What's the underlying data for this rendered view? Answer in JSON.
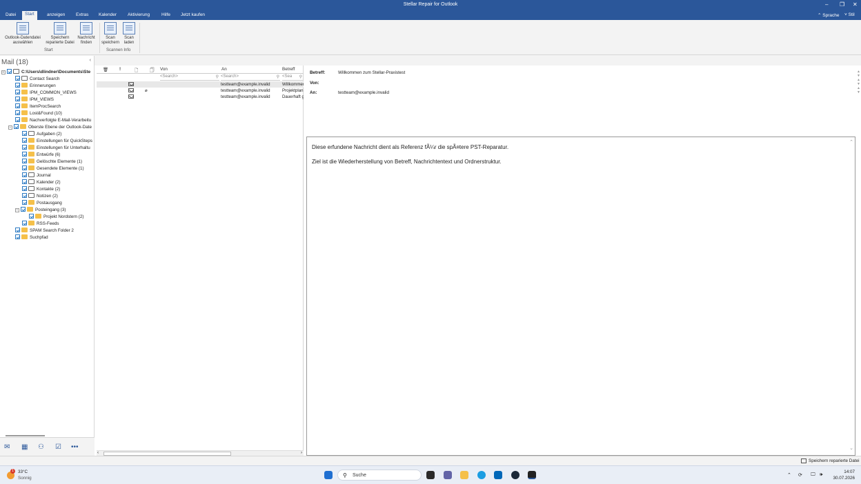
{
  "window": {
    "title": "Stellar Repair for Outlook"
  },
  "menu": {
    "items": [
      "Datei",
      "Start",
      "anzeigen",
      "Extras",
      "Kalender",
      "Aktivierung",
      "Hilfe",
      "Jetzt kaufen"
    ],
    "active": "Start",
    "sprache": "Sprache",
    "stil": "Stil"
  },
  "ribbon": {
    "buttons": [
      {
        "label1": "Outlook-Datendatei",
        "label2": "auswählen"
      },
      {
        "label1": "Speichern",
        "label2": "reparierte Datei"
      },
      {
        "label1": "Nachricht",
        "label2": "finden"
      },
      {
        "label1": "Scan",
        "label2": "speichern"
      },
      {
        "label1": "Scan",
        "label2": "laden"
      }
    ],
    "groups": [
      "Start",
      "Scannen Info"
    ]
  },
  "folders": {
    "title": "Mail (18)",
    "root": "C:\\Users\\dlindner\\Documents\\Ste",
    "items": [
      "Contact Search",
      "Erinnerungen",
      "IPM_COMMON_VIEWS",
      "IPM_VIEWS",
      "ItemProcSearch",
      "Lost&Found (10)",
      "Nachverfolgte E-Mail-Verarbeitu",
      "Oberste Ebene der Outlook-Date",
      "Aufgaben (2)",
      "Einstellungen für QuickSteps",
      "Einstellungen für Unterhaltu",
      "Entwürfe (6)",
      "Gelöschte Elemente (1)",
      "Gesendete Elemente (1)",
      "Journal",
      "Kalender (2)",
      "Kontakte (2)",
      "Notizen (2)",
      "Postausgang",
      "Posteingang (3)",
      "Projekt Nordstern (2)",
      "RSS-Feeds",
      "SPAM Search Folder 2",
      "Suchpfad"
    ]
  },
  "list": {
    "headers": {
      "from": "Von",
      "to": "An",
      "subject": "Betreff"
    },
    "search_placeholder": "<Search>",
    "search_short": "<Sea",
    "rows": [
      {
        "to": "testteam@example.invalid",
        "subject": "Willkommen"
      },
      {
        "to": "testteam@example.invalid",
        "subject": "Projektplan"
      },
      {
        "to": "testteam@example.invalid",
        "subject": "Dauerhaft g"
      }
    ]
  },
  "reading": {
    "subject_label": "Betreff:",
    "subject": "Willkommen zum Stellar-Praxistest",
    "from_label": "Von:",
    "from": "",
    "to_label": "An:",
    "to": "testteam@example.invalid",
    "body1": "Diese erfundene Nachricht dient als Referenz fÃ¼r die spÃ¤tere PST-Reparatur.",
    "body2": "Ziel ist die Wiederherstellung von Betreff, Nachrichtentext und Ordnerstruktur."
  },
  "status": {
    "right": "Speichern reparierte Datei"
  },
  "taskbar": {
    "temp": "33°C",
    "weather": "Sonnig",
    "badge": "1",
    "search": "Suche",
    "time": "14:07",
    "date": "30.07.2026"
  }
}
